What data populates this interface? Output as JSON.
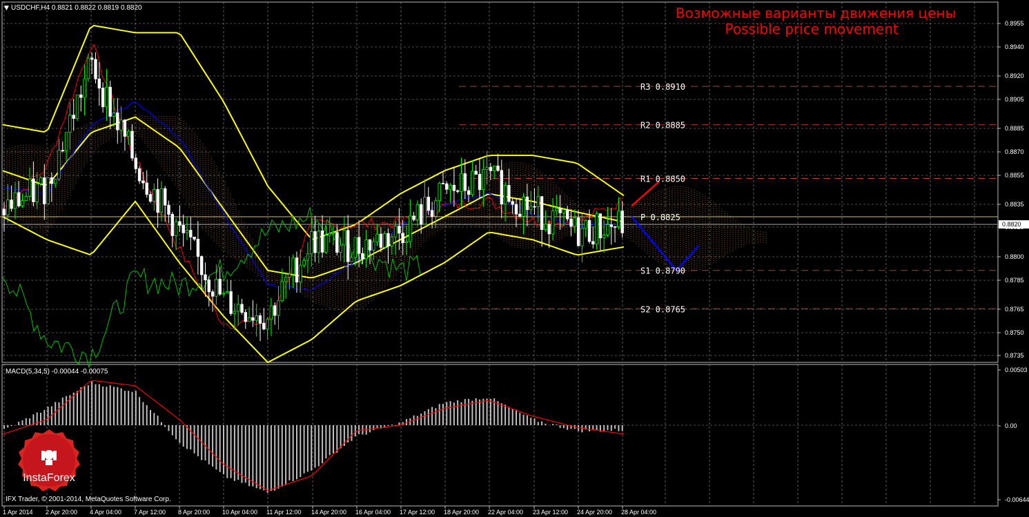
{
  "header": {
    "symbol_line": "USDCHF,H4  0.8821 0.8822 0.8819 0.8820",
    "overlay_title_ru": "Возможные варианты движения цены",
    "overlay_title_en": "Possible price movement"
  },
  "macd_header": "MACD(5,34,5) -0.00044 -0.00075",
  "footer": {
    "copyright": "IFX Trader, © 2001-2014, MetaQuotes Software Corp."
  },
  "logo": {
    "text": "InstaForex"
  },
  "price_axis": {
    "ticks": [
      "0.8955",
      "0.8940",
      "0.8920",
      "0.8905",
      "0.8885",
      "0.8870",
      "0.8855",
      "0.8835",
      "0.8820",
      "0.8800",
      "0.8785",
      "0.8765",
      "0.8750",
      "0.8735"
    ],
    "current_price": "0.8820"
  },
  "macd_axis": {
    "ticks": [
      "0.00503",
      "0.00",
      "-0.00644"
    ]
  },
  "time_axis": {
    "labels": [
      "1 Apr 2014",
      "2 Apr 20:00",
      "4 Apr 04:00",
      "7 Apr 12:00",
      "8 Apr 20:00",
      "10 Apr 04:00",
      "11 Apr 12:00",
      "14 Apr 20:00",
      "16 Apr 04:00",
      "17 Apr 12:00",
      "18 Apr 20:00",
      "22 Apr 04:00",
      "23 Apr 12:00",
      "24 Apr 20:00",
      "28 Apr 04:00"
    ]
  },
  "pivot_levels": [
    {
      "label": "R3  0.8910",
      "value": 0.891
    },
    {
      "label": "R2  0.8885",
      "value": 0.8885
    },
    {
      "label": "R1  0.8850",
      "value": 0.885
    },
    {
      "label": "P  0.8825",
      "value": 0.8825
    },
    {
      "label": "S1  0.8790",
      "value": 0.879
    },
    {
      "label": "S2  0.8765",
      "value": 0.8765
    }
  ],
  "colors": {
    "background": "#000000",
    "grid": "#9a9a9a",
    "bull_candle": "#00ff00",
    "bear_candle": "#ffffff",
    "bollinger": "#ffff00",
    "tenkan": "#ff0000",
    "kijun": "#0000ff",
    "chikou": "#00c000",
    "cloud": "#ff9a3c",
    "pivot_line": "#c0392b",
    "overlay_text": "#ff0000",
    "macd_hist": "#c0c0c0",
    "macd_signal": "#ff0000",
    "projection_up": "#ff0000",
    "projection_down": "#0000ff",
    "current_price_line": "#bfbfbf"
  },
  "chart_data": {
    "type": "line",
    "x": [
      "1 Apr 2014",
      "2 Apr 20:00",
      "4 Apr 04:00",
      "7 Apr 12:00",
      "8 Apr 20:00",
      "10 Apr 04:00",
      "11 Apr 12:00",
      "14 Apr 20:00",
      "16 Apr 04:00",
      "17 Apr 12:00",
      "18 Apr 20:00",
      "22 Apr 04:00",
      "23 Apr 12:00",
      "24 Apr 20:00",
      "28 Apr 04:00"
    ],
    "ylim": [
      0.873,
      0.8965
    ],
    "price": [
      0.883,
      0.8845,
      0.8925,
      0.886,
      0.8815,
      0.877,
      0.876,
      0.881,
      0.8805,
      0.8815,
      0.884,
      0.885,
      0.883,
      0.8815,
      0.882
    ],
    "bollinger_upper": [
      0.8885,
      0.888,
      0.895,
      0.8945,
      0.8945,
      0.89,
      0.8845,
      0.881,
      0.882,
      0.884,
      0.8855,
      0.8865,
      0.8865,
      0.886,
      0.884
    ],
    "bollinger_middle": [
      0.8855,
      0.8845,
      0.888,
      0.889,
      0.887,
      0.883,
      0.879,
      0.8785,
      0.8795,
      0.881,
      0.8825,
      0.884,
      0.8835,
      0.8828,
      0.8822
    ],
    "bollinger_lower": [
      0.8825,
      0.881,
      0.88,
      0.8835,
      0.8795,
      0.876,
      0.873,
      0.8745,
      0.877,
      0.878,
      0.8795,
      0.8815,
      0.881,
      0.88,
      0.8805
    ],
    "macd_ylim": [
      -0.00644,
      0.00503
    ],
    "macd_hist": [
      -0.0005,
      0.0015,
      0.0038,
      0.003,
      -0.0015,
      -0.0045,
      -0.006,
      -0.004,
      -0.001,
      0.0002,
      0.002,
      0.0025,
      0.0005,
      -0.0005,
      -0.00044
    ],
    "macd_signal": [
      -0.0008,
      0.0005,
      0.004,
      0.0035,
      0.0005,
      -0.0035,
      -0.0058,
      -0.0045,
      -0.0005,
      0.0,
      0.0015,
      0.0022,
      0.0008,
      -0.0002,
      -0.00075
    ]
  }
}
